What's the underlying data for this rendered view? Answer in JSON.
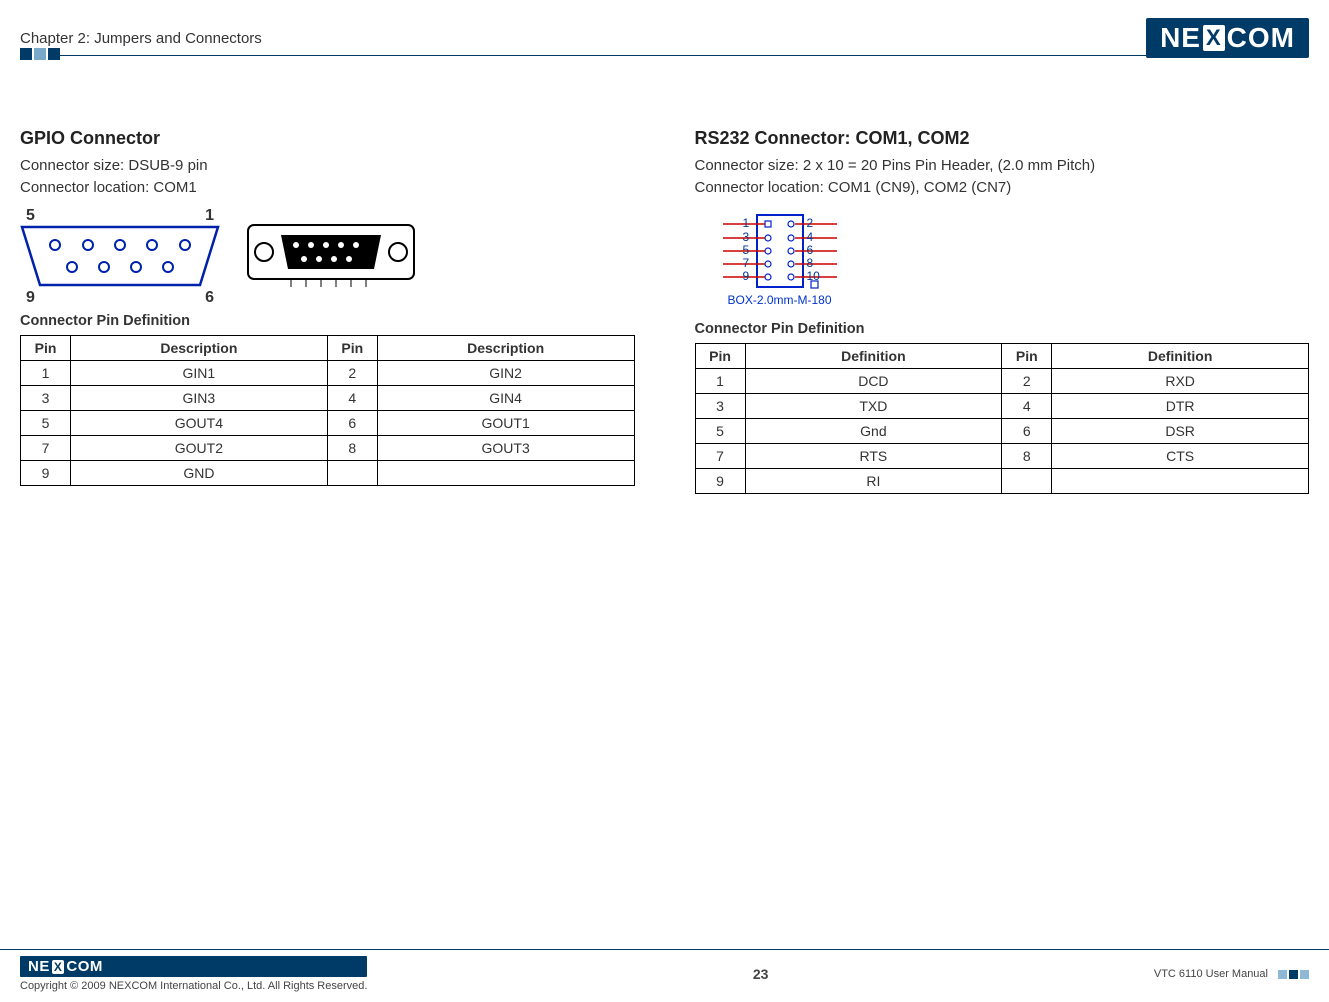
{
  "header": {
    "chapter": "Chapter 2: Jumpers and Connectors",
    "brand_left": "NE",
    "brand_mid": "X",
    "brand_right": "COM"
  },
  "left": {
    "title": "GPIO Connector",
    "size": "Connector size: DSUB-9 pin",
    "location": "Connector location: COM1",
    "diagram_pins": {
      "tl": "5",
      "tr": "1",
      "bl": "9",
      "br": "6"
    },
    "pin_def_title": "Connector Pin Definition",
    "table": {
      "headers": [
        "Pin",
        "Description",
        "Pin",
        "Description"
      ],
      "rows": [
        [
          "1",
          "GIN1",
          "2",
          "GIN2"
        ],
        [
          "3",
          "GIN3",
          "4",
          "GIN4"
        ],
        [
          "5",
          "GOUT4",
          "6",
          "GOUT1"
        ],
        [
          "7",
          "GOUT2",
          "8",
          "GOUT3"
        ],
        [
          "9",
          "GND",
          "",
          ""
        ]
      ]
    }
  },
  "right": {
    "title": "RS232 Connector: COM1, COM2",
    "size": "Connector size: 2 x 10 = 20 Pins Pin Header, (2.0 mm Pitch)",
    "location": "Connector location: COM1 (CN9), COM2 (CN7)",
    "box_pins_left": [
      "1",
      "3",
      "5",
      "7",
      "9"
    ],
    "box_pins_right": [
      "2",
      "4",
      "6",
      "8",
      "10"
    ],
    "box_caption": "BOX-2.0mm-M-180",
    "pin_def_title": "Connector Pin Definition",
    "table": {
      "headers": [
        "Pin",
        "Definition",
        "Pin",
        "Definition"
      ],
      "rows": [
        [
          "1",
          "DCD",
          "2",
          "RXD"
        ],
        [
          "3",
          "TXD",
          "4",
          "DTR"
        ],
        [
          "5",
          "Gnd",
          "6",
          "DSR"
        ],
        [
          "7",
          "RTS",
          "8",
          "CTS"
        ],
        [
          "9",
          "RI",
          "",
          ""
        ]
      ]
    }
  },
  "footer": {
    "copyright": "Copyright © 2009 NEXCOM International Co., Ltd. All Rights Reserved.",
    "page": "23",
    "doc": "VTC 6110 User Manual"
  }
}
